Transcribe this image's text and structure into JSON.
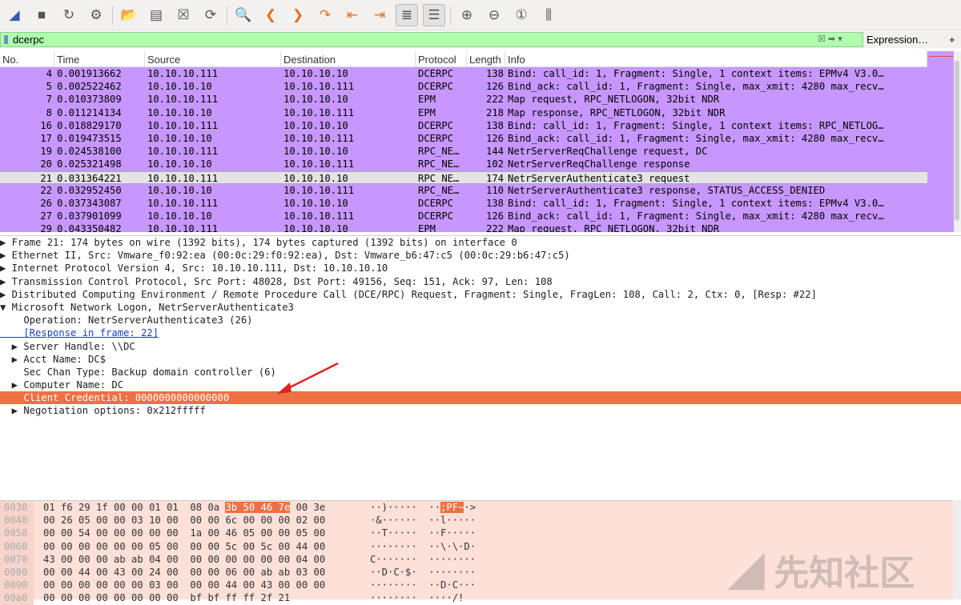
{
  "toolbar": {
    "icons": [
      "shark-fin-start-icon",
      "stop-icon",
      "restart-icon",
      "options-gear-icon",
      "open-file-icon",
      "file-set-icon",
      "close-file-icon",
      "reload-icon",
      "find-icon",
      "back-icon",
      "forward-icon",
      "goto-packet-icon",
      "first-packet-icon",
      "last-packet-icon",
      "autoscroll-icon",
      "colorize-icon",
      "zoom-in-icon",
      "zoom-out-icon",
      "normal-size-icon",
      "resize-columns-icon"
    ]
  },
  "filter": {
    "value": "dcerpc",
    "expression_label": "Expression…",
    "plus": "+"
  },
  "columns": [
    "No.",
    "Time",
    "Source",
    "Destination",
    "Protocol",
    "Length",
    "Info"
  ],
  "packets": [
    [
      "4",
      "0.001913662",
      "10.10.10.111",
      "10.10.10.10",
      "DCERPC",
      "138",
      "Bind: call_id: 1, Fragment: Single, 1 context items: EPMv4 V3.0…"
    ],
    [
      "5",
      "0.002522462",
      "10.10.10.10",
      "10.10.10.111",
      "DCERPC",
      "126",
      "Bind_ack: call_id: 1, Fragment: Single, max_xmit: 4280 max_recv…"
    ],
    [
      "7",
      "0.010373809",
      "10.10.10.111",
      "10.10.10.10",
      "EPM",
      "222",
      "Map request, RPC_NETLOGON, 32bit NDR"
    ],
    [
      "8",
      "0.011214134",
      "10.10.10.10",
      "10.10.10.111",
      "EPM",
      "218",
      "Map response, RPC_NETLOGON, 32bit NDR"
    ],
    [
      "16",
      "0.018829170",
      "10.10.10.111",
      "10.10.10.10",
      "DCERPC",
      "138",
      "Bind: call_id: 1, Fragment: Single, 1 context items: RPC_NETLOG…"
    ],
    [
      "17",
      "0.019473515",
      "10.10.10.10",
      "10.10.10.111",
      "DCERPC",
      "126",
      "Bind_ack: call_id: 1, Fragment: Single, max_xmit: 4280 max_recv…"
    ],
    [
      "19",
      "0.024538100",
      "10.10.10.111",
      "10.10.10.10",
      "RPC_NE…",
      "144",
      "NetrServerReqChallenge request, DC"
    ],
    [
      "20",
      "0.025321498",
      "10.10.10.10",
      "10.10.10.111",
      "RPC_NE…",
      "102",
      "NetrServerReqChallenge response"
    ],
    [
      "21",
      "0.031364221",
      "10.10.10.111",
      "10.10.10.10",
      "RPC_NE…",
      "174",
      "NetrServerAuthenticate3 request"
    ],
    [
      "22",
      "0.032952450",
      "10.10.10.10",
      "10.10.10.111",
      "RPC_NE…",
      "110",
      "NetrServerAuthenticate3 response, STATUS_ACCESS_DENIED"
    ],
    [
      "26",
      "0.037343087",
      "10.10.10.111",
      "10.10.10.10",
      "DCERPC",
      "138",
      "Bind: call_id: 1, Fragment: Single, 1 context items: EPMv4 V3.0…"
    ],
    [
      "27",
      "0.037901099",
      "10.10.10.10",
      "10.10.10.111",
      "DCERPC",
      "126",
      "Bind_ack: call_id: 1, Fragment: Single, max_xmit: 4280 max_recv…"
    ],
    [
      "29",
      "0.043350482",
      "10.10.10.111",
      "10.10.10.10",
      "EPM",
      "222",
      "Map request, RPC_NETLOGON, 32bit NDR"
    ]
  ],
  "selected_packet": "21",
  "details": [
    {
      "t": "▶ Frame 21: 174 bytes on wire (1392 bits), 174 bytes captured (1392 bits) on interface 0"
    },
    {
      "t": "▶ Ethernet II, Src: Vmware_f0:92:ea (00:0c:29:f0:92:ea), Dst: Vmware_b6:47:c5 (00:0c:29:b6:47:c5)"
    },
    {
      "t": "▶ Internet Protocol Version 4, Src: 10.10.10.111, Dst: 10.10.10.10"
    },
    {
      "t": "▶ Transmission Control Protocol, Src Port: 48028, Dst Port: 49156, Seq: 151, Ack: 97, Len: 108"
    },
    {
      "t": "▶ Distributed Computing Environment / Remote Procedure Call (DCE/RPC) Request, Fragment: Single, FragLen: 108, Call: 2, Ctx: 0, [Resp: #22]"
    },
    {
      "t": "▼ Microsoft Network Logon, NetrServerAuthenticate3"
    },
    {
      "t": "    Operation: NetrServerAuthenticate3 (26)"
    },
    {
      "t": "    [Response in frame: 22]",
      "link": true
    },
    {
      "t": "  ▶ Server Handle: \\\\DC"
    },
    {
      "t": "  ▶ Acct Name: DC$"
    },
    {
      "t": "    Sec Chan Type: Backup domain controller (6)"
    },
    {
      "t": "  ▶ Computer Name: DC"
    },
    {
      "t": "    Client Credential: 0000000000000000",
      "hl": true
    },
    {
      "t": "  ▶ Negotiation options: 0x212fffff"
    }
  ],
  "hex": [
    {
      "off": "0030",
      "a": "01 f6 29 1f 00 00 01 01  08 0a ",
      "h": "3b 50 46 7e",
      "b": " 00 3e",
      "asc_a": "··)·····  ··",
      "asc_h": ";PF~",
      "asc_b": "·>"
    },
    {
      "off": "0040",
      "a": "00 26 05 00 00 03 10 00  00 00 6c 00 00 00 02 00",
      "asc_a": "·&······  ··l·····"
    },
    {
      "off": "0050",
      "a": "00 00 54 00 00 00 00 00  1a 00 46 05 00 00 05 00",
      "asc_a": "··T·····  ··F·····"
    },
    {
      "off": "0060",
      "a": "00 00 00 00 00 00 05 00  00 00 5c 00 5c 00 44 00",
      "asc_a": "········  ··\\·\\·D·"
    },
    {
      "off": "0070",
      "a": "43 00 00 00 ab ab 04 00  00 00 00 00 00 00 04 00",
      "asc_a": "C·······  ········"
    },
    {
      "off": "0080",
      "a": "00 00 44 00 43 00 24 00  00 00 06 00 ab ab 03 00",
      "asc_a": "··D·C·$·  ········"
    },
    {
      "off": "0090",
      "a": "00 00 00 00 00 00 03 00  00 00 44 00 43 00 00 00",
      "asc_a": "········  ··D·C···"
    },
    {
      "off": "00a0",
      "a": "00 00 00 00 00 00 00 00  bf bf ff ff 2f 21",
      "asc_a": "········  ····/!"
    }
  ],
  "watermark": "先知社区",
  "colors": {
    "row": "#c797ff",
    "highlight": "#ee7044",
    "filter_ok": "#afffaf",
    "hex_bg": "#fde0d8"
  }
}
